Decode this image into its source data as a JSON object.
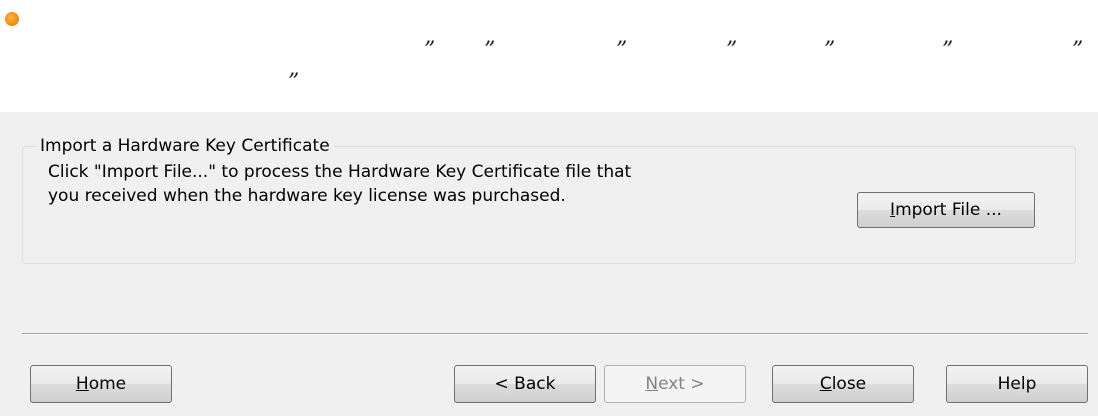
{
  "header": {
    "quote_left": "”",
    "quote_right": "”"
  },
  "group": {
    "title": "Import a Hardware Key Certificate",
    "line1": "Click \"Import File...\" to process the Hardware Key Certificate file that",
    "line2": "you received when the hardware key license was purchased.",
    "import_button": {
      "prefix": "",
      "accel": "I",
      "rest": "mport File ..."
    }
  },
  "footer": {
    "home": {
      "prefix": "",
      "accel": "H",
      "rest": "ome"
    },
    "back": {
      "label": "< Back"
    },
    "next": {
      "prefix": "",
      "accel": "N",
      "rest": "ext >"
    },
    "close": {
      "prefix": "",
      "accel": "C",
      "rest": "lose"
    },
    "help": {
      "label": "Help"
    }
  },
  "colors": {
    "bullet": "#f28c0f",
    "dialog_bg": "#f0f0f0"
  }
}
